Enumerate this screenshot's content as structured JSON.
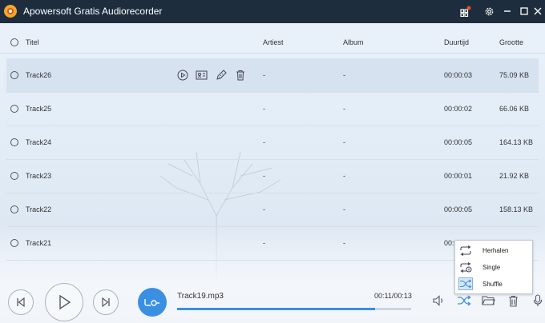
{
  "window": {
    "title": "Apowersoft Gratis Audiorecorder"
  },
  "table": {
    "headers": {
      "title": "Titel",
      "artist": "Artiest",
      "album": "Album",
      "duration": "Duurtijd",
      "size": "Grootte"
    },
    "rows": [
      {
        "title": "Track26",
        "artist": "-",
        "album": "-",
        "duration": "00:00:03",
        "size": "75.09 KB"
      },
      {
        "title": "Track25",
        "artist": "-",
        "album": "-",
        "duration": "00:00:02",
        "size": "66.06 KB"
      },
      {
        "title": "Track24",
        "artist": "-",
        "album": "-",
        "duration": "00:00:05",
        "size": "164.13 KB"
      },
      {
        "title": "Track23",
        "artist": "-",
        "album": "-",
        "duration": "00:00:01",
        "size": "21.92 KB"
      },
      {
        "title": "Track22",
        "artist": "-",
        "album": "-",
        "duration": "00:00:05",
        "size": "158.13 KB"
      },
      {
        "title": "Track21",
        "artist": "-",
        "album": "-",
        "duration": "00:0",
        "size": ""
      }
    ]
  },
  "player": {
    "track": "Track19.mp3",
    "time": "00:11/00:13",
    "progress": 0.846
  },
  "popup": {
    "items": [
      {
        "label": "Herhalen",
        "icon": "repeat-icon"
      },
      {
        "label": "Single",
        "icon": "repeat-one-icon"
      },
      {
        "label": "Shuffle",
        "icon": "shuffle-icon"
      }
    ]
  },
  "colors": {
    "accent": "#3a8fe3",
    "titlebar": "#1d2d3d",
    "notification": "#e0541f"
  }
}
